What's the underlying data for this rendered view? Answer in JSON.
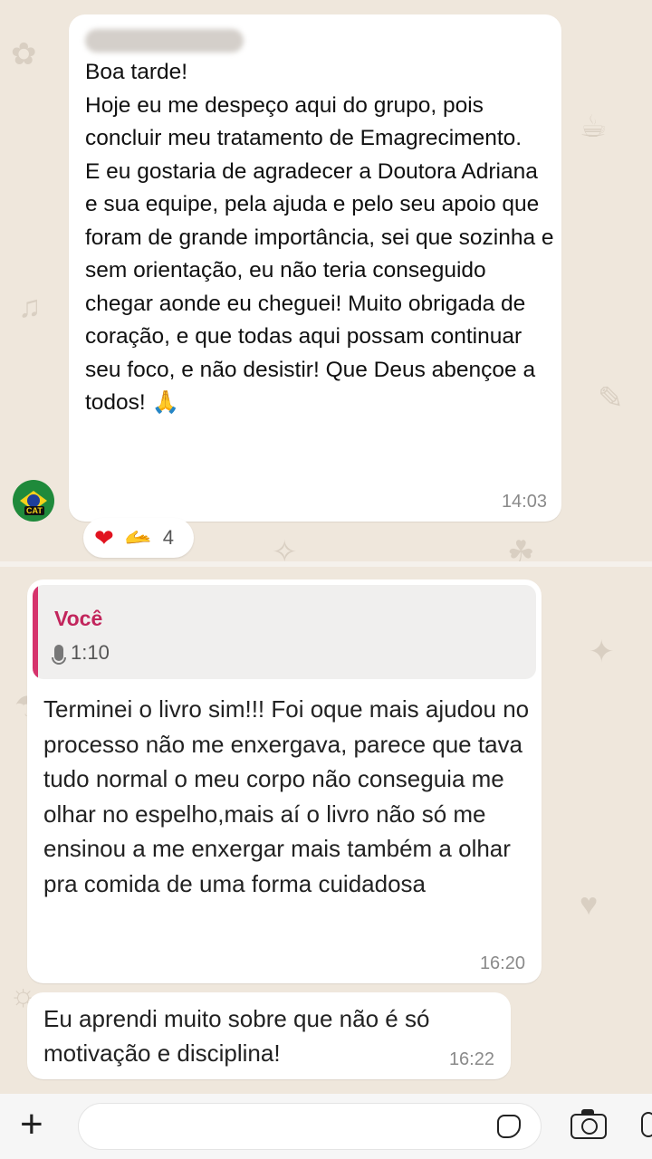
{
  "messages": {
    "m1": {
      "text": "Boa tarde!\nHoje eu me despeço aqui do grupo, pois concluir meu tratamento de Emagrecimento.\nE eu gostaria de agradecer a Doutora Adriana e sua equipe, pela ajuda e pelo seu apoio que foram de grande importância, sei que sozinha e sem orientação, eu não teria conseguido chegar aonde eu cheguei! Muito obrigada de coração, e que todas aqui possam continuar seu foco, e não desistir! Que Deus abençoe a todos! 🙏",
      "time": "14:03",
      "reactions": {
        "heart": "❤",
        "hand": "🫴",
        "count": "4"
      }
    },
    "m2": {
      "quote_name": "Você",
      "quote_audio": "1:10",
      "text": "Terminei o livro sim!!! Foi oque mais ajudou no processo não me enxergava, parece que tava tudo normal o meu corpo não conseguia me olhar no espelho,mais aí o livro não só me ensinou a me enxergar mais também a olhar pra comida de uma forma cuidadosa",
      "time": "16:20"
    },
    "m3": {
      "text": "Eu aprendi muito sobre que não é só motivação e disciplina!",
      "time": "16:22"
    }
  },
  "input_bar": {
    "plus_symbol": "+"
  },
  "icons": [
    "plus-icon",
    "sticker-icon",
    "camera-icon",
    "microphone-icon"
  ],
  "colors": {
    "quote_accent": "#d6336c",
    "quote_name": "#c2255c",
    "background": "#efe7dc"
  }
}
